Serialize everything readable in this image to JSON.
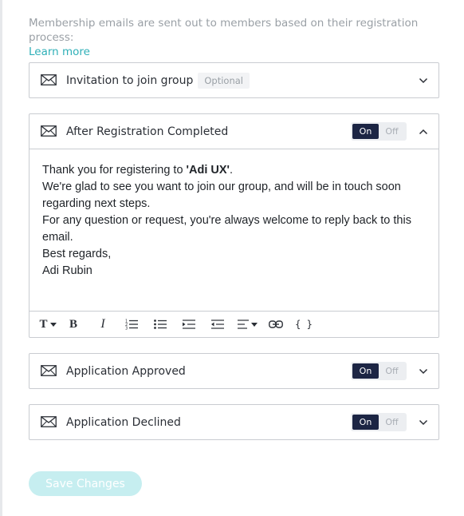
{
  "intro": {
    "text": "Membership emails are sent out to members based on their registration process:",
    "link": "Learn more"
  },
  "panels": [
    {
      "title": "Invitation to join group",
      "badge": "Optional",
      "expanded": false
    },
    {
      "title": "After Registration Completed",
      "toggle_on": "On",
      "toggle_off": "Off",
      "state": "On",
      "expanded": true
    },
    {
      "title": "Application Approved",
      "toggle_on": "On",
      "toggle_off": "Off",
      "state": "On",
      "expanded": false
    },
    {
      "title": "Application Declined",
      "toggle_on": "On",
      "toggle_off": "Off",
      "state": "On",
      "expanded": false
    }
  ],
  "email": {
    "line1_pre": "Thank you for registering to ",
    "line1_bold": "'Adi UX'",
    "line1_post": ".",
    "line2": "We're glad to see you want to join our group, and will be in touch soon regarding next steps.",
    "line3": "For any question or request, you're always welcome to reply back to this email.",
    "line4": "Best regards,",
    "line5": "Adi Rubin"
  },
  "toolbar": {
    "icons": [
      "text-style-icon",
      "bold-icon",
      "italic-icon",
      "ordered-list-icon",
      "bullet-list-icon",
      "indent-icon",
      "outdent-icon",
      "align-icon",
      "link-icon",
      "code-braces-icon"
    ],
    "text_label": "T",
    "bold_label": "B",
    "italic_label": "I",
    "code_label": "{ }"
  },
  "save_button": "Save Changes",
  "colors": {
    "accent": "#2fb0b8",
    "toggle_on_bg": "#1c2544",
    "save_disabled_bg": "#c6eef0",
    "border": "#c9ccd1"
  }
}
